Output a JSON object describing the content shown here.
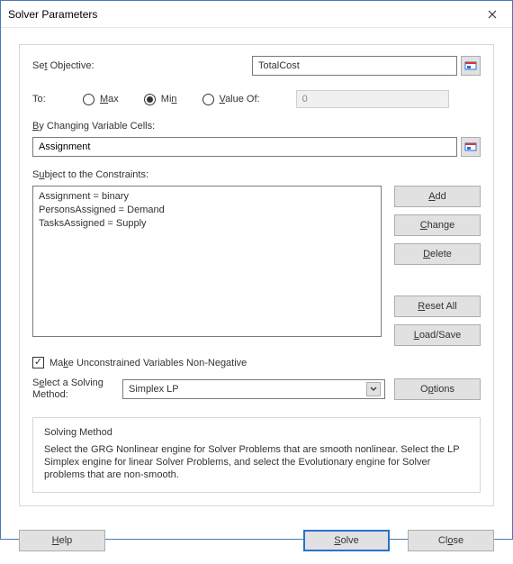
{
  "title": "Solver Parameters",
  "objective": {
    "label_prefix": "Se",
    "label_ul": "t",
    "label_suffix": " Objective:",
    "value": "TotalCost"
  },
  "to": {
    "label": "To:",
    "max_ul": "M",
    "max_suffix": "ax",
    "min_prefix": "Mi",
    "min_ul": "n",
    "valueof_ul": "V",
    "valueof_suffix": "alue Of:",
    "valueof_input": "0",
    "selected": "min"
  },
  "cells": {
    "label_ul": "B",
    "label_suffix": "y Changing Variable Cells:",
    "value": "Assignment"
  },
  "constraints": {
    "label_prefix": "S",
    "label_ul": "u",
    "label_suffix": "bject to the Constraints:",
    "items": [
      "Assignment = binary",
      "PersonsAssigned = Demand",
      "TasksAssigned = Supply"
    ]
  },
  "buttons": {
    "add_ul": "A",
    "add_suffix": "dd",
    "change_ul": "C",
    "change_suffix": "hange",
    "delete_ul": "D",
    "delete_suffix": "elete",
    "reset_ul": "R",
    "reset_suffix": "eset All",
    "load_ul": "L",
    "load_suffix": "oad/Save",
    "options_prefix": "O",
    "options_ul": "p",
    "options_suffix": "tions",
    "help_ul": "H",
    "help_suffix": "elp",
    "solve_ul": "S",
    "solve_suffix": "olve",
    "close_prefix": "Cl",
    "close_ul": "o",
    "close_suffix": "se"
  },
  "checkbox": {
    "prefix": "Ma",
    "ul": "k",
    "suffix": "e Unconstrained Variables Non-Negative",
    "checked": true
  },
  "method": {
    "label_prefix": "S",
    "label_ul": "e",
    "label_suffix": "lect a Solving Method:",
    "value": "Simplex LP"
  },
  "group": {
    "title": "Solving Method",
    "text": "Select the GRG Nonlinear engine for Solver Problems that are smooth nonlinear. Select the LP Simplex engine for linear Solver Problems, and select the Evolutionary engine for Solver problems that are non-smooth."
  }
}
